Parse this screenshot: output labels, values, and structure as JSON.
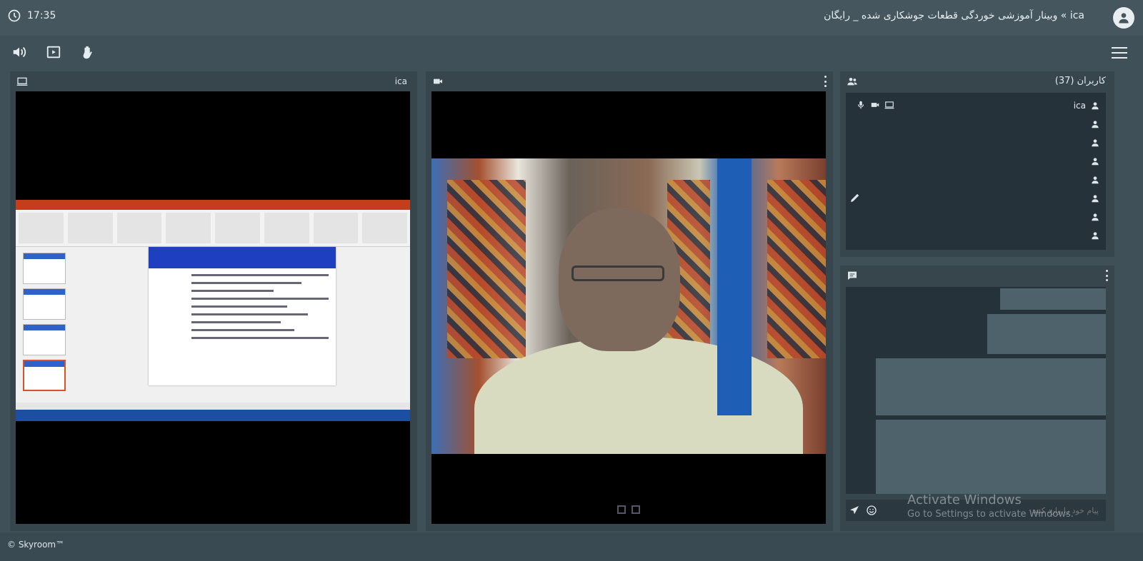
{
  "header": {
    "time": "17:35",
    "room_title": "ica » وبینار آموزشی خوردگی قطعات جوشکاری شده _ رایگان"
  },
  "screen_panel": {
    "tag": "ica"
  },
  "users_panel": {
    "count_label": "کاربران (37)",
    "users": [
      {
        "name": "ica",
        "has_media": true
      },
      {
        "name": "",
        "has_media": false
      },
      {
        "name": "",
        "has_media": false
      },
      {
        "name": "",
        "has_media": false
      },
      {
        "name": "",
        "has_media": false
      },
      {
        "name": "",
        "has_media": false
      },
      {
        "name": "",
        "has_media": false
      },
      {
        "name": "",
        "has_media": false
      }
    ]
  },
  "chat_panel": {
    "input_placeholder": "پیام خود را وارد کنید"
  },
  "watermark": {
    "line1": "Activate Windows",
    "line2": "Go to Settings to activate Windows."
  },
  "footer": {
    "brand": "© Skyroom™"
  },
  "colors": {
    "background": "#3f5058",
    "panel": "#37464d",
    "list": "#25323a"
  }
}
